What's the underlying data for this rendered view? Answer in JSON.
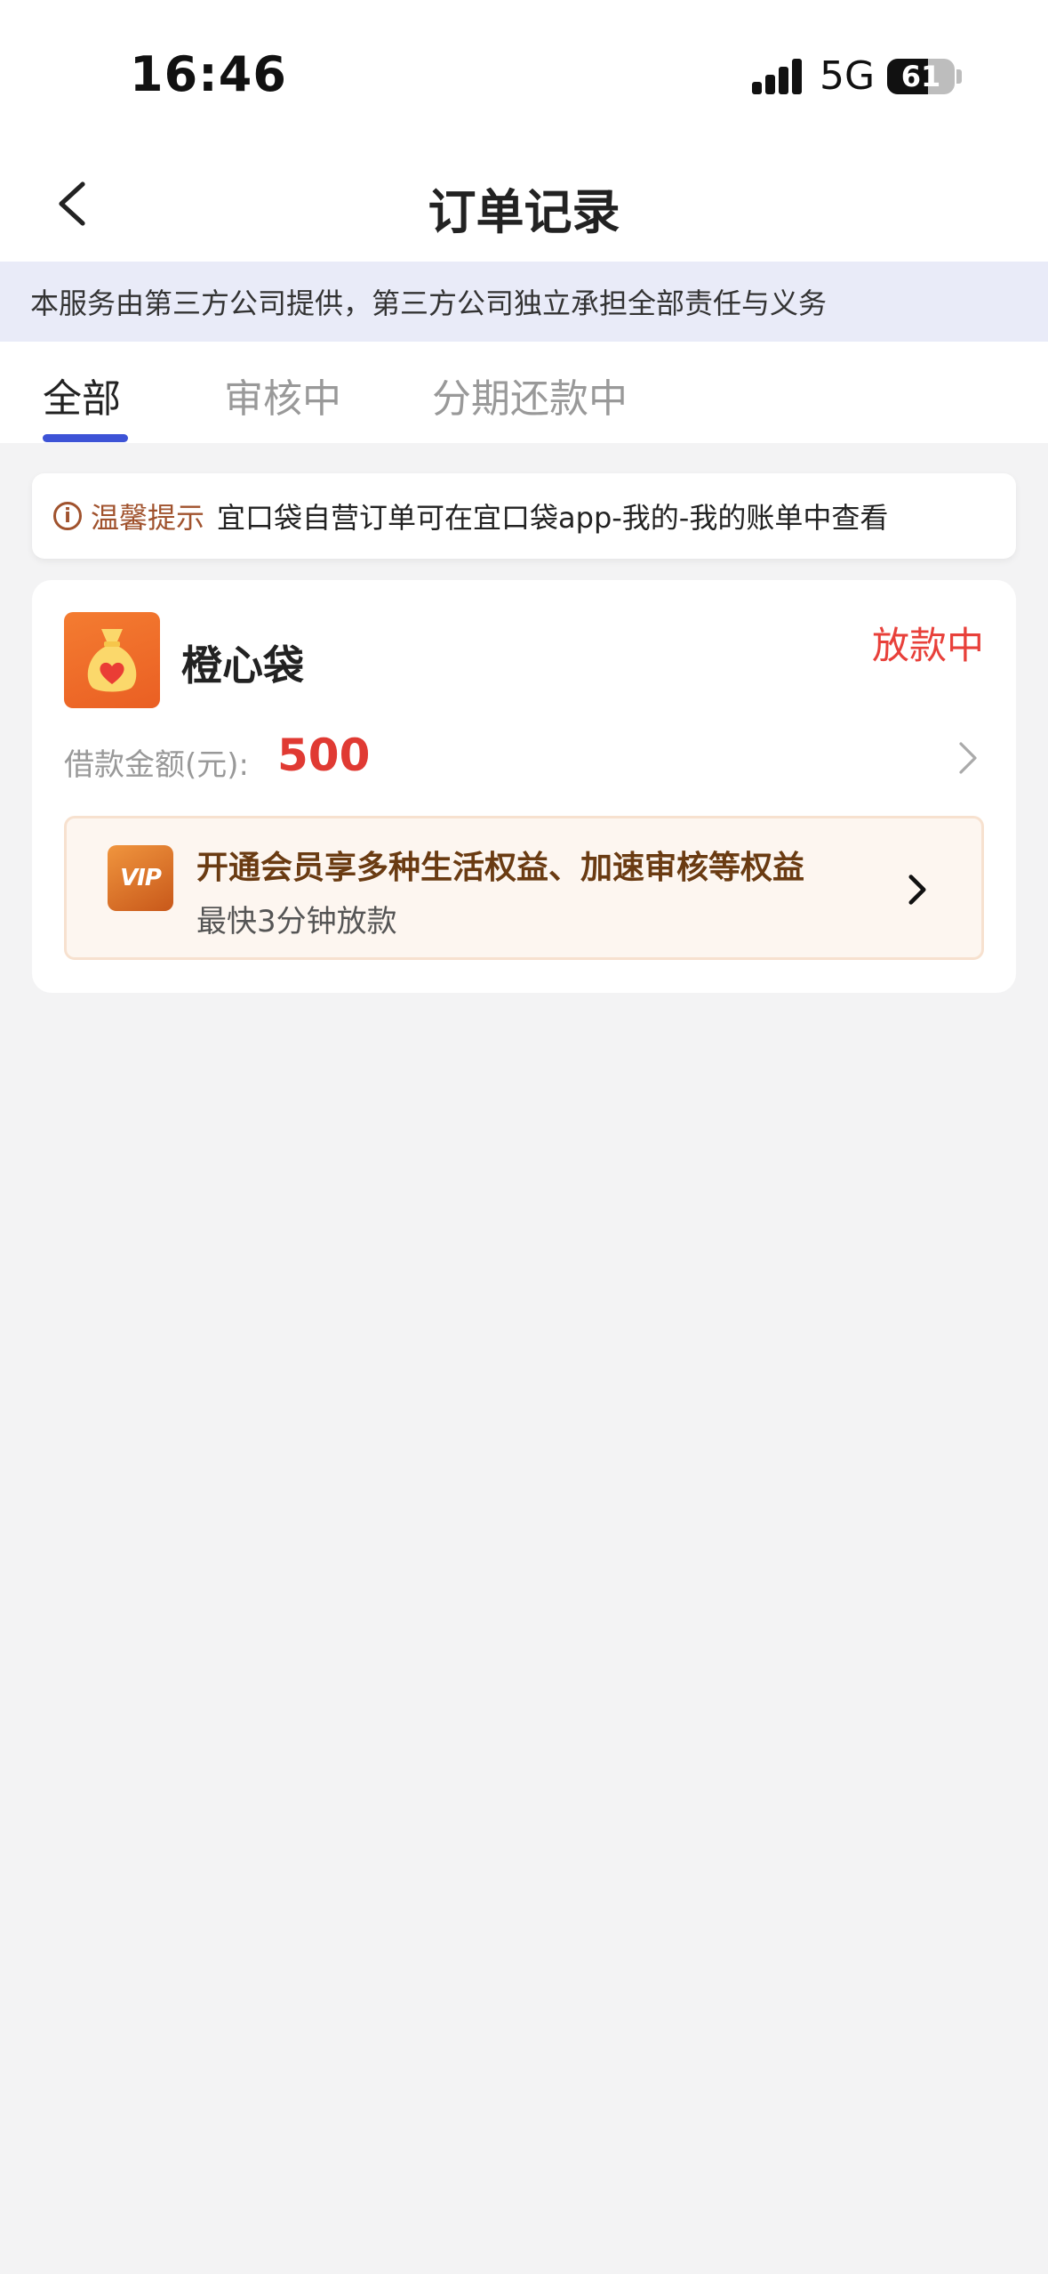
{
  "status_bar": {
    "time": "16:46",
    "network": "5G",
    "battery": "61",
    "battery_level_percent": 61
  },
  "nav": {
    "title": "订单记录",
    "back_icon": "chevron-left-icon"
  },
  "disclaimer": {
    "text": "本服务由第三方公司提供，第三方公司独立承担全部责任与义务"
  },
  "tabs": [
    {
      "label": "全部",
      "active": true
    },
    {
      "label": "审核中",
      "active": false
    },
    {
      "label": "分期还款中",
      "active": false
    }
  ],
  "tip": {
    "icon": "info-icon",
    "label": "温馨提示",
    "text": "宜口袋自营订单可在宜口袋app-我的-我的账单中查看"
  },
  "order": {
    "app_name": "橙心袋",
    "status": "放款中",
    "amount_label": "借款金额(元):",
    "amount_value": "500",
    "logo_icon": "money-bag-heart-icon",
    "vip": {
      "icon_text": "VIP",
      "title": "开通会员享多种生活权益、加速审核等权益",
      "subtitle": "最快3分钟放款"
    }
  },
  "colors": {
    "accent_tab": "#3d53d6",
    "status_red": "#e8403a",
    "amount_red": "#e03a33",
    "tip_brown": "#a0522d",
    "vip_title": "#6a3b12",
    "logo_orange": "#f47c31"
  }
}
